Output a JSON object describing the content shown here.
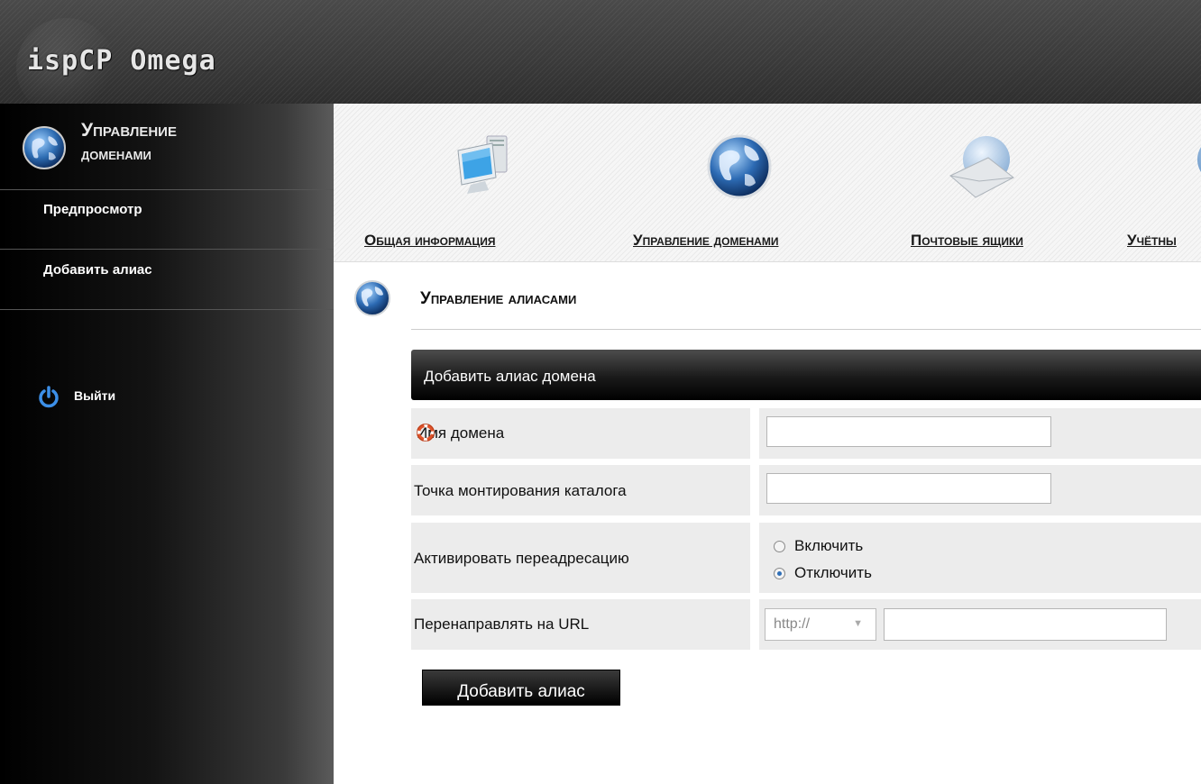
{
  "header": {
    "logo_text": "ispCP Omega"
  },
  "sidebar": {
    "title_line1": "Управление",
    "title_line2": "доменами",
    "links": [
      {
        "label": "Предпросмотр"
      },
      {
        "label": "Добавить алиас"
      }
    ],
    "logout_label": "Выйти"
  },
  "menu": {
    "items": [
      {
        "label": "Общая информация",
        "icon": "computer-icon"
      },
      {
        "label": "Управление доменами",
        "icon": "globe-icon"
      },
      {
        "label": "Почтовые ящики",
        "icon": "mail-icon"
      },
      {
        "label": "Учётны",
        "icon": "globe-icon"
      }
    ]
  },
  "page": {
    "title": "Управление алиасами"
  },
  "form": {
    "header": "Добавить алиас домена",
    "rows": {
      "domain_name": {
        "label": "Имя домена",
        "value": ""
      },
      "mount_point": {
        "label": "Точка монтирования каталога",
        "value": ""
      },
      "redirect": {
        "label": "Активировать переадресацию",
        "options": [
          {
            "label": "Включить",
            "checked": false
          },
          {
            "label": "Отключить",
            "checked": true
          }
        ]
      },
      "redirect_url": {
        "label": "Перенаправлять на URL",
        "protocol": "http://",
        "value": ""
      }
    },
    "submit_label": "Добавить алиас"
  },
  "colors": {
    "header_bg": "#3a3a3a",
    "sidebar_bg": "#000000",
    "form_header_bg": "#1a1a1a",
    "row_bg": "#ececec",
    "radio_accent": "#2f6fb7"
  }
}
